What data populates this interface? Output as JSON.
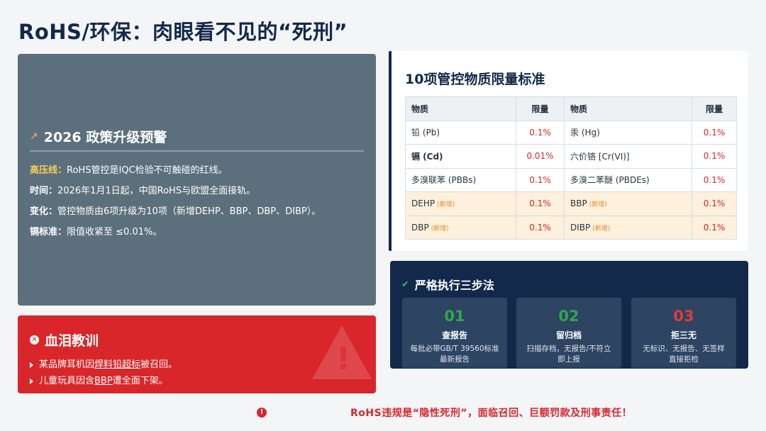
{
  "title": "RoHS/环保：肉眼看不见的“死刑”",
  "policy": {
    "heading": "2026 政策升级预警",
    "items": [
      {
        "key": "高压线：",
        "text": "RoHS管控是IQC检验不可触碰的红线。"
      },
      {
        "key": "时间：",
        "text": "2026年1月1日起，中国RoHS与欧盟全面接轨。"
      },
      {
        "key": "变化：",
        "text": "管控物质由6项升级为10项（新增DEHP、BBP、DBP、DIBP）。"
      },
      {
        "key": "镉标准：",
        "text": "限值收紧至 ≤0.01%。"
      }
    ]
  },
  "lesson": {
    "heading": "血泪教训",
    "items": [
      {
        "pre": "某品牌耳机因",
        "u": "焊料铅超标",
        "post": "被召回。"
      },
      {
        "pre": "儿童玩具因含",
        "u": "BBP",
        "post": "遭全面下架。"
      }
    ]
  },
  "standards": {
    "title": "10项管控物质限量标准",
    "headers": [
      "物质",
      "限量",
      "物质",
      "限量"
    ],
    "new_tag": "(新增)",
    "rows": [
      {
        "s1": "铅 (Pb)",
        "v1": "0.1%",
        "s2": "汞 (Hg)",
        "v2": "0.1%"
      },
      {
        "s1": "镉 (Cd)",
        "v1": "0.01%",
        "s2": "六价铬 [Cr(VI)]",
        "v2": "0.1%"
      },
      {
        "s1": "多溴联苯 (PBBs)",
        "v1": "0.1%",
        "s2": "多溴二苯醚 (PBDEs)",
        "v2": "0.1%"
      },
      {
        "s1": "DEHP",
        "v1": "0.1%",
        "s2": "BBP",
        "v2": "0.1%"
      },
      {
        "s1": "DBP",
        "v1": "0.1%",
        "s2": "DIBP",
        "v2": "0.1%"
      }
    ]
  },
  "steps": {
    "heading": "严格执行三步法",
    "items": [
      {
        "num": "01",
        "label": "查报告",
        "line1": "每批必带GB/T 39560标准",
        "line2": "最新报告"
      },
      {
        "num": "02",
        "label": "留归档",
        "line1": "扫描存档，无报告/不符立",
        "line2": "即上报"
      },
      {
        "num": "03",
        "label": "拒三无",
        "line1": "无标识、无报告、无签样",
        "line2": "直接拒检"
      }
    ]
  },
  "footer": "RoHS违规是“隐性死刑”，面临召回、巨额罚款及刑事责任！"
}
